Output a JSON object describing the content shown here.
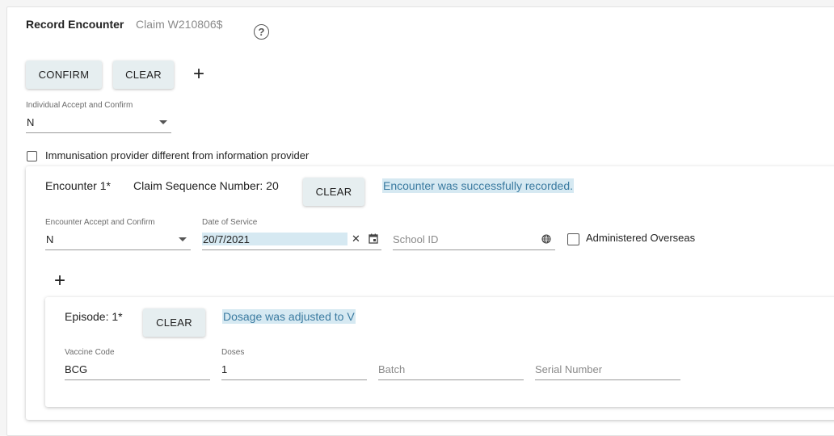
{
  "header": {
    "title": "Record Encounter",
    "claim": "Claim W210806$",
    "help_icon": "?"
  },
  "toolbar": {
    "confirm_label": "CONFIRM",
    "clear_label": "CLEAR",
    "add_icon": "+"
  },
  "individual_accept": {
    "label": "Individual Accept and Confirm",
    "value": "N"
  },
  "immunisation_checkbox": {
    "label": "Immunisation provider different from information provider",
    "checked": false
  },
  "encounter": {
    "title": "Encounter 1*",
    "sequence": "Claim Sequence Number: 20",
    "clear_label": "CLEAR",
    "message": "Encounter was successfully recorded.",
    "accept_label": "Encounter Accept and Confirm",
    "accept_value": "N",
    "date_label": "Date of Service",
    "date_value": "20/7/2021",
    "clear_icon": "✕",
    "school_placeholder": "School ID",
    "overseas_label": "Administered Overseas",
    "overseas_checked": false,
    "add_icon": "+"
  },
  "episode": {
    "title": "Episode: 1*",
    "clear_label": "CLEAR",
    "message": "Dosage was adjusted to V",
    "vaccine_label": "Vaccine Code",
    "vaccine_value": "BCG",
    "doses_label": "Doses",
    "doses_value": "1",
    "batch_placeholder": "Batch",
    "serial_placeholder": "Serial Number"
  },
  "colors": {
    "button_bg": "#e6eef0",
    "message_bg": "#d6e9f2",
    "message_text": "#3a7aa0"
  }
}
